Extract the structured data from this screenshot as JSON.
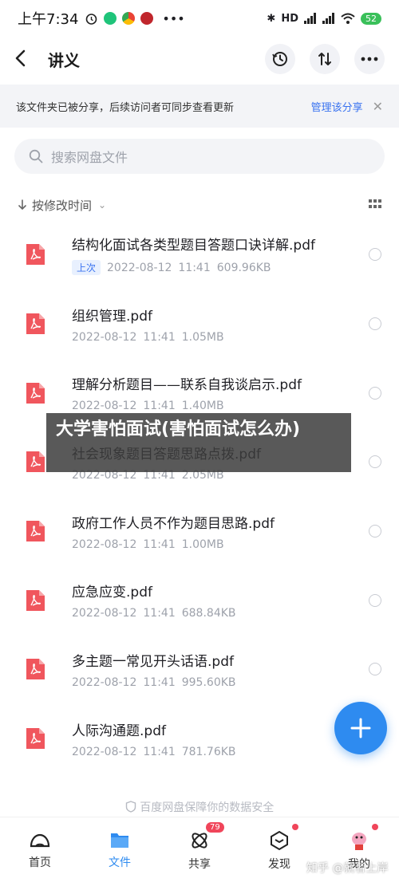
{
  "status": {
    "time": "上午7:34",
    "network": "HD",
    "battery": "52"
  },
  "header": {
    "title": "讲义"
  },
  "banner": {
    "text": "该文件夹已被分享，后续访问者可同步查看更新",
    "link": "管理该分享",
    "close": "✕"
  },
  "search": {
    "placeholder": "搜索网盘文件"
  },
  "sort": {
    "label": "按修改时间",
    "caret": "⌄"
  },
  "files": [
    {
      "name": "结构化面试各类型题目答题口诀详解.pdf",
      "badge": "上次",
      "date": "2022-08-12",
      "time": "11:41",
      "size": "609.96KB"
    },
    {
      "name": "组织管理.pdf",
      "date": "2022-08-12",
      "time": "11:41",
      "size": "1.05MB"
    },
    {
      "name": "理解分析题目——联系自我谈启示.pdf",
      "date": "2022-08-12",
      "time": "11:41",
      "size": "1.40MB"
    },
    {
      "name": "社会现象题目答题思路点拨.pdf",
      "date": "2022-08-12",
      "time": "11:41",
      "size": "2.05MB"
    },
    {
      "name": "政府工作人员不作为题目思路.pdf",
      "date": "2022-08-12",
      "time": "11:41",
      "size": "1.00MB"
    },
    {
      "name": "应急应变.pdf",
      "date": "2022-08-12",
      "time": "11:41",
      "size": "688.84KB"
    },
    {
      "name": "多主题一常见开头话语.pdf",
      "date": "2022-08-12",
      "time": "11:41",
      "size": "995.60KB"
    },
    {
      "name": "人际沟通题.pdf",
      "date": "2022-08-12",
      "time": "11:41",
      "size": "781.76KB"
    }
  ],
  "overlay": {
    "title": "大学害怕面试(害怕面试怎么办)"
  },
  "safety": {
    "text": "百度网盘保障你的数据安全"
  },
  "tabs": [
    {
      "label": "首页",
      "icon": "home-icon"
    },
    {
      "label": "文件",
      "icon": "folder-icon"
    },
    {
      "label": "共享",
      "icon": "share-icon",
      "badge": "79"
    },
    {
      "label": "发现",
      "icon": "discover-icon"
    },
    {
      "label": "我的",
      "icon": "profile-avatar-icon"
    }
  ],
  "watermark": {
    "text": "知乎 @就者上岸"
  },
  "colors": {
    "accent": "#2e8bf0",
    "link": "#3a73f0",
    "pdf": "#f0565d"
  }
}
